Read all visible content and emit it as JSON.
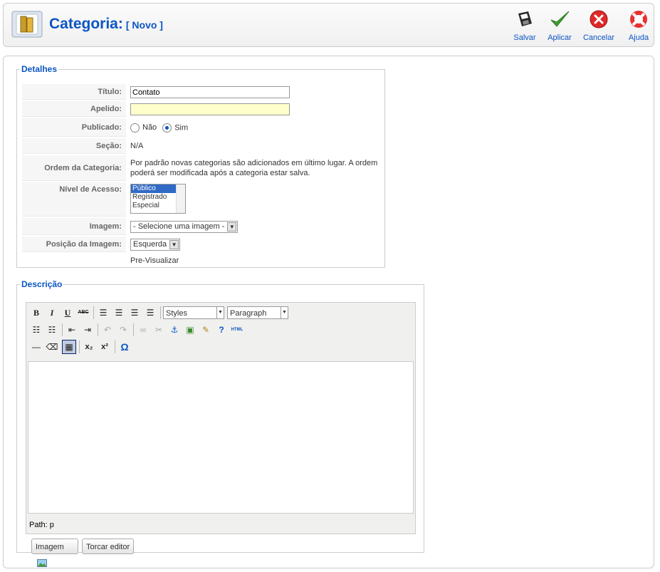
{
  "header": {
    "title": "Categoria:",
    "subtitle": "[ Novo ]",
    "buttons": [
      {
        "label": "Salvar",
        "icon": "save-icon"
      },
      {
        "label": "Aplicar",
        "icon": "check-icon"
      },
      {
        "label": "Cancelar",
        "icon": "cancel-icon"
      },
      {
        "label": "Ajuda",
        "icon": "help-icon"
      }
    ]
  },
  "details": {
    "legend": "Detalhes",
    "title_label": "Título:",
    "title_value": "Contato",
    "alias_label": "Apelido:",
    "alias_value": "",
    "published_label": "Publicado:",
    "published_no": "Não",
    "published_yes": "Sim",
    "published_selected": "Sim",
    "section_label": "Seção:",
    "section_value": "N/A",
    "order_label": "Ordem da Categoria:",
    "order_line1": "Por padrão novas categorias são adicionados em último lugar. A ordem",
    "order_line2": "poderá ser modificada após a categoria estar salva.",
    "access_label": "Nível de Acesso:",
    "access_options": [
      "Público",
      "Registrado",
      "Especial"
    ],
    "access_selected": "Público",
    "image_label": "Imagem:",
    "image_value": "- Selecione uma imagem -",
    "image_pos_label": "Posição da Imagem:",
    "image_pos_value": "Esquerda",
    "preview_label": "Pre-Visualizar"
  },
  "description": {
    "legend": "Descrição",
    "styles_value": "Styles",
    "format_value": "Paragraph",
    "path_text": "Path: p",
    "image_button": "Imagem",
    "toggle_button": "Torcar editor"
  },
  "colors": {
    "accent": "#0b55c4",
    "highlight": "#ffffcc"
  }
}
